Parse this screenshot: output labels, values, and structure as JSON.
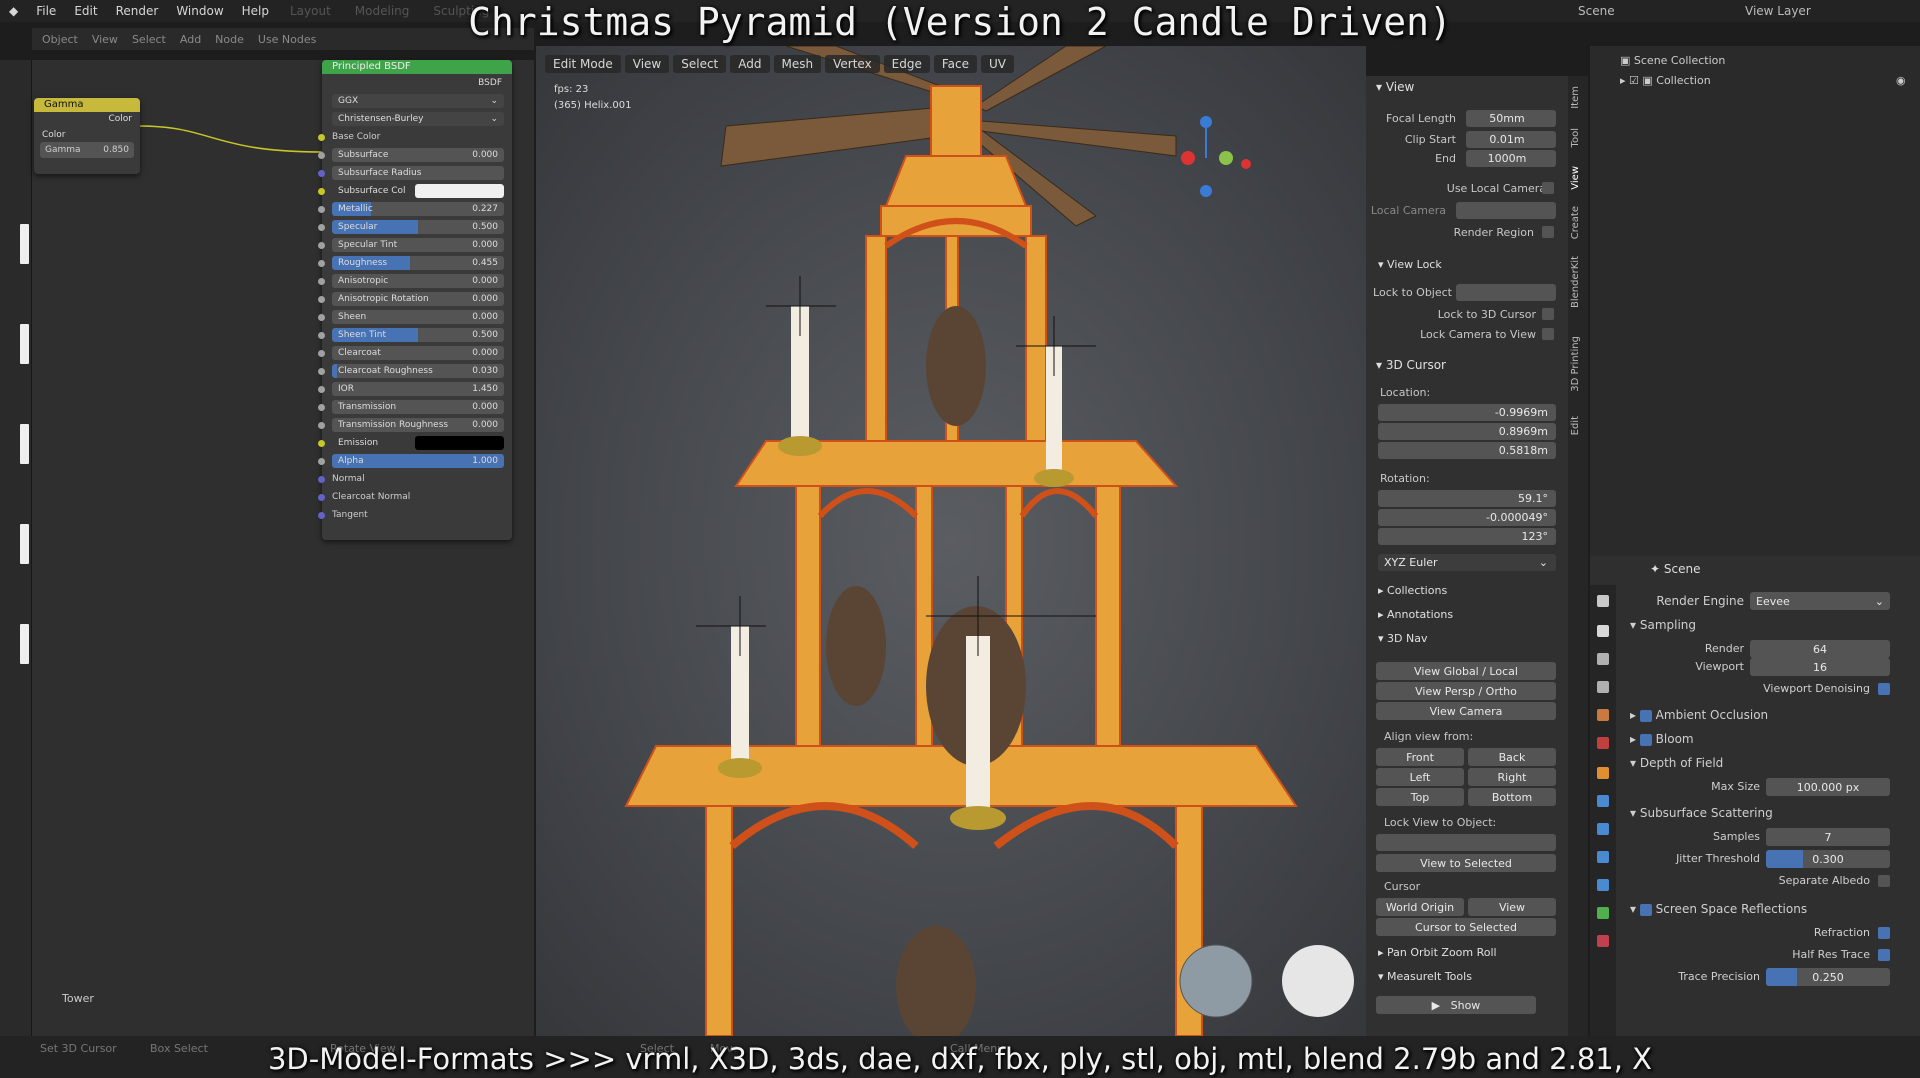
{
  "title_overlay": "Christmas Pyramid (Version 2 Candle Driven)",
  "caption_overlay": "3D-Model-Formats >>> vrml, X3D, 3ds, dae, dxf, fbx, ply, stl, obj, mtl, blend 2.79b and 2.81, X",
  "menu": [
    "File",
    "Edit",
    "Render",
    "Window",
    "Help"
  ],
  "workspaces": [
    "Layout",
    "Modeling",
    "Sculpting"
  ],
  "scene_label": "Scene",
  "viewlayer_label": "View Layer",
  "node_header": [
    "Object",
    "View",
    "Select",
    "Add",
    "Node",
    "Use Nodes"
  ],
  "gamma_node": {
    "title": "Gamma",
    "out": "Color",
    "in": "Color",
    "param": "Gamma",
    "value": "0.850"
  },
  "bsdf_node": {
    "title": "Principled BSDF",
    "out": "BSDF",
    "dist": "GGX",
    "ss_method": "Christensen-Burley",
    "base_color": "Base Color",
    "rows": [
      {
        "label": "Subsurface",
        "value": "0.000",
        "fill": 0
      },
      {
        "label": "Subsurface Radius",
        "value": "",
        "fill": 0
      },
      {
        "label": "Subsurface Col",
        "value": "",
        "fill": 0
      },
      {
        "label": "Metallic",
        "value": "0.227",
        "fill": 0.227
      },
      {
        "label": "Specular",
        "value": "0.500",
        "fill": 0.5
      },
      {
        "label": "Specular Tint",
        "value": "0.000",
        "fill": 0
      },
      {
        "label": "Roughness",
        "value": "0.455",
        "fill": 0.455
      },
      {
        "label": "Anisotropic",
        "value": "0.000",
        "fill": 0
      },
      {
        "label": "Anisotropic Rotation",
        "value": "0.000",
        "fill": 0
      },
      {
        "label": "Sheen",
        "value": "0.000",
        "fill": 0
      },
      {
        "label": "Sheen Tint",
        "value": "0.500",
        "fill": 0.5
      },
      {
        "label": "Clearcoat",
        "value": "0.000",
        "fill": 0
      },
      {
        "label": "Clearcoat Roughness",
        "value": "0.030",
        "fill": 0.03
      },
      {
        "label": "IOR",
        "value": "1.450",
        "fill": 0
      },
      {
        "label": "Transmission",
        "value": "0.000",
        "fill": 0
      },
      {
        "label": "Transmission Roughness",
        "value": "0.000",
        "fill": 0
      },
      {
        "label": "Emission",
        "value": "",
        "fill": 0
      },
      {
        "label": "Alpha",
        "value": "1.000",
        "fill": 1
      }
    ],
    "sockets": [
      "Normal",
      "Clearcoat Normal",
      "Tangent"
    ]
  },
  "node_footer": "Tower",
  "viewport": {
    "mode": "Edit Mode",
    "menus": [
      "View",
      "Select",
      "Add",
      "Mesh",
      "Vertex",
      "Edge",
      "Face",
      "UV"
    ],
    "fps": "fps: 23",
    "object": "(365) Helix.001"
  },
  "npanel": {
    "view": "View",
    "focal_length_label": "Focal Length",
    "focal_length": "50mm",
    "clip_start_label": "Clip Start",
    "clip_start": "0.01m",
    "end_label": "End",
    "end": "1000m",
    "use_local_camera": "Use Local Camera",
    "local_camera": "Local Camera",
    "render_region": "Render Region",
    "view_lock": "View Lock",
    "lock_to_object": "Lock to Object",
    "lock_to_cursor": "Lock to 3D Cursor",
    "lock_camera": "Lock Camera to View",
    "cursor_3d": "3D Cursor",
    "location": "Location:",
    "loc": {
      "x": "-0.9969m",
      "y": "0.8969m",
      "z": "0.5818m"
    },
    "rotation": "Rotation:",
    "rot": {
      "x": "59.1°",
      "y": "-0.000049°",
      "z": "123°"
    },
    "euler": "XYZ Euler",
    "collections": "Collections",
    "annotations": "Annotations",
    "nav3d": "3D Nav",
    "view_global_local": "View Global / Local",
    "view_persp_ortho": "View Persp / Ortho",
    "view_camera": "View Camera",
    "align_view": "Align view from:",
    "front": "Front",
    "back": "Back",
    "left": "Left",
    "right": "Right",
    "top": "Top",
    "bottom": "Bottom",
    "lock_view_obj": "Lock View to Object:",
    "view_selected": "View to Selected",
    "cursor": "Cursor",
    "world_origin": "World Origin",
    "cursor_selected": "Cursor to Selected",
    "pan_orbit": "Pan Orbit Zoom Roll",
    "measureit": "MeasureIt Tools",
    "show": "Show",
    "tabs": [
      "Item",
      "Tool",
      "View",
      "Create",
      "BlenderKit",
      "3D Printing",
      "Edit"
    ]
  },
  "outliner": {
    "root": "Scene Collection",
    "child": "Collection"
  },
  "props": {
    "scene": "Scene",
    "render_engine_label": "Render Engine",
    "render_engine": "Eevee",
    "sampling": "Sampling",
    "render_label": "Render",
    "render_val": "64",
    "viewport_label": "Viewport",
    "viewport_val": "16",
    "viewport_denoise": "Viewport Denoising",
    "ao": "Ambient Occlusion",
    "bloom": "Bloom",
    "dof": "Depth of Field",
    "max_size_label": "Max Size",
    "max_size": "100.000 px",
    "sss": "Subsurface Scattering",
    "samples_label": "Samples",
    "samples": "7",
    "jitter_label": "Jitter Threshold",
    "jitter": "0.300",
    "jitter_fill": 0.3,
    "sep_albedo": "Separate Albedo",
    "ssr": "Screen Space Reflections",
    "refraction": "Refraction",
    "half_res": "Half Res Trace",
    "trace_label": "Trace Precision",
    "trace": "0.250",
    "trace_fill": 0.25
  },
  "status": [
    "Set 3D Cursor",
    "Box Select",
    "Rotate View",
    "Select",
    "Move",
    "Call Menu"
  ]
}
